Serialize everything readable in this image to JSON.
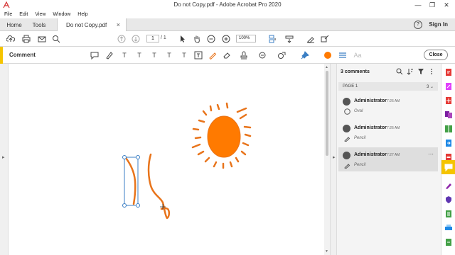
{
  "window": {
    "title": "Do not Copy.pdf - Adobe Acrobat Pro 2020",
    "controls": [
      "—",
      "❐",
      "✕"
    ]
  },
  "menu": [
    "File",
    "Edit",
    "View",
    "Window",
    "Help"
  ],
  "tabs": {
    "home": "Home",
    "tools": "Tools",
    "document": "Do not Copy.pdf",
    "close": "×",
    "help": "?",
    "signin": "Sign In"
  },
  "toolbar": {
    "page_current": "1",
    "page_total": "/ 1",
    "zoom": "100%"
  },
  "comment_toolbar": {
    "label": "Comment",
    "text_tools": [
      "T",
      "T",
      "T",
      "T",
      "T"
    ],
    "text_style": "Aa",
    "close": "Close",
    "accent": "#f5c400",
    "color_swatch": "#ff7a00"
  },
  "comments_panel": {
    "count": "3 comments",
    "page_label": "PAGE 1",
    "page_count": "3 ⌄",
    "items": [
      {
        "author": "Administrator",
        "time": "7:26 AM",
        "type": "Oval"
      },
      {
        "author": "Administrator",
        "time": "7:26 AM",
        "type": "Pencil"
      },
      {
        "author": "Administrator",
        "time": "7:27 AM",
        "type": "Pencil",
        "more": "⋯"
      }
    ]
  },
  "drawing": {
    "stroke_color": "#e8741b",
    "fill_color": "#ff7a00",
    "selection_color": "#3b7fc4"
  },
  "right_rail": {
    "icons": [
      "pdf-export-icon",
      "edit-pdf-icon",
      "create-pdf-icon",
      "combine-icon",
      "organize-icon",
      "export-icon",
      "comment-icon",
      "fill-sign-icon",
      "protect-icon",
      "print-icon",
      "more-tools-icon"
    ],
    "active": "comment-icon"
  }
}
